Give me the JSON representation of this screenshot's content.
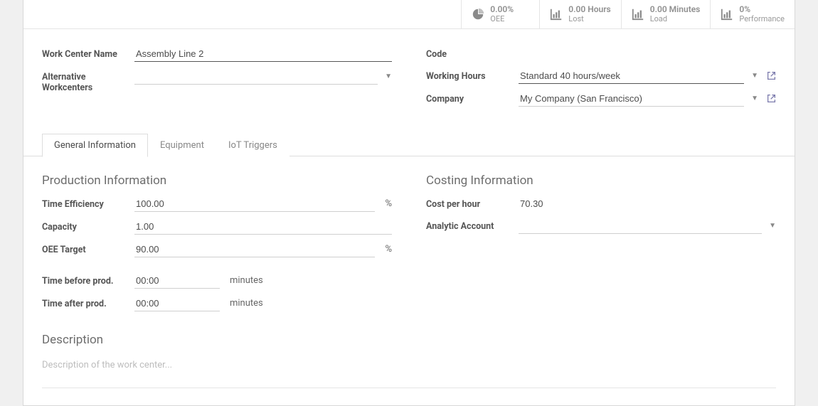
{
  "kpis": {
    "oee": {
      "value": "0.00%",
      "label": "OEE"
    },
    "lost": {
      "value": "0.00 Hours",
      "label": "Lost"
    },
    "load": {
      "value": "0.00 Minutes",
      "label": "Load"
    },
    "performance": {
      "value": "0%",
      "label": "Performance"
    }
  },
  "fields": {
    "name_label": "Work Center Name",
    "name_value": "Assembly Line 2",
    "alt_label": "Alternative Workcenters",
    "alt_value": "",
    "code_label": "Code",
    "code_value": "",
    "hours_label": "Working Hours",
    "hours_value": "Standard 40 hours/week",
    "company_label": "Company",
    "company_value": "My Company (San Francisco)"
  },
  "tabs": {
    "general": "General Information",
    "equipment": "Equipment",
    "iot": "IoT Triggers"
  },
  "production": {
    "heading": "Production Information",
    "time_eff_label": "Time Efficiency",
    "time_eff_value": "100.00",
    "time_eff_unit": "%",
    "capacity_label": "Capacity",
    "capacity_value": "1.00",
    "oee_target_label": "OEE Target",
    "oee_target_value": "90.00",
    "oee_target_unit": "%",
    "time_before_label": "Time before prod.",
    "time_before_value": "00:00",
    "time_before_unit": "minutes",
    "time_after_label": "Time after prod.",
    "time_after_value": "00:00",
    "time_after_unit": "minutes"
  },
  "costing": {
    "heading": "Costing Information",
    "cost_label": "Cost per hour",
    "cost_value": "70.30",
    "analytic_label": "Analytic Account",
    "analytic_value": ""
  },
  "description": {
    "heading": "Description",
    "placeholder": "Description of the work center..."
  }
}
